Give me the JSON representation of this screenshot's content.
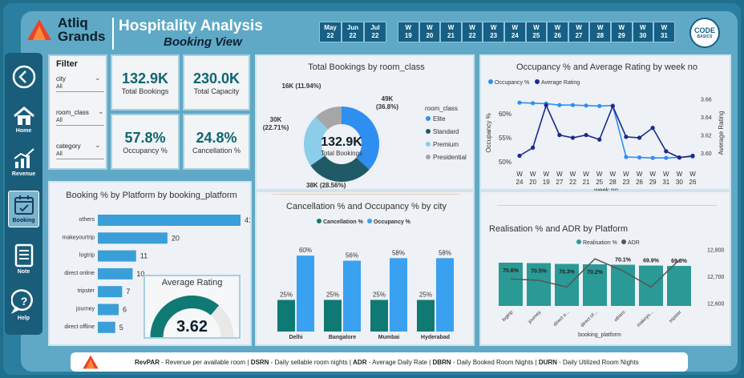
{
  "brand": {
    "name_line1": "Atliq",
    "name_line2": "Grands"
  },
  "header": {
    "title": "Hospitality Analysis",
    "subtitle": "Booking View"
  },
  "month_chips": [
    [
      "May",
      "22"
    ],
    [
      "Jun",
      "22"
    ],
    [
      "Jul",
      "22"
    ]
  ],
  "week_chips": [
    [
      "W",
      "19"
    ],
    [
      "W",
      "20"
    ],
    [
      "W",
      "21"
    ],
    [
      "W",
      "22"
    ],
    [
      "W",
      "23"
    ],
    [
      "W",
      "24"
    ],
    [
      "W",
      "25"
    ],
    [
      "W",
      "26"
    ],
    [
      "W",
      "27"
    ],
    [
      "W",
      "28"
    ],
    [
      "W",
      "29"
    ],
    [
      "W",
      "30"
    ],
    [
      "W",
      "31"
    ]
  ],
  "codebasics": {
    "line1": "CODE",
    "line2": "BASICS"
  },
  "nav": {
    "home": "Home",
    "revenue": "Revenue",
    "booking": "Booking",
    "note": "Note",
    "help": "Help"
  },
  "filter": {
    "title": "Filter",
    "city_label": "city",
    "city_value": "All",
    "room_class_label": "room_class",
    "room_class_value": "All",
    "category_label": "category",
    "category_value": "All"
  },
  "kpis": {
    "total_bookings": {
      "value": "132.9K",
      "label": "Total Bookings"
    },
    "total_capacity": {
      "value": "230.0K",
      "label": "Total Capacity"
    },
    "occupancy": {
      "value": "57.8%",
      "label": "Occupancy %"
    },
    "cancellation": {
      "value": "24.8%",
      "label": "Cancellation %"
    }
  },
  "colors": {
    "teal_dark": "#0f7a74",
    "blue": "#3aa0f0",
    "navy": "#1e3aa0",
    "platform_bar": "#3a9fd8"
  },
  "chart_data": [
    {
      "id": "booking_pct_platform",
      "type": "bar",
      "title": "Booking % by Platform by booking_platform",
      "categories": [
        "others",
        "makeyourtrip",
        "logtrip",
        "direct online",
        "tripster",
        "journey",
        "direct offline"
      ],
      "values": [
        41,
        20,
        11,
        10,
        7,
        6,
        5
      ]
    },
    {
      "id": "bookings_by_room_class",
      "type": "pie",
      "title": "Total Bookings by room_class",
      "center_value": "132.9K",
      "center_label": "Total Bookings",
      "legend_title": "room_class",
      "labels": [
        "Elite",
        "Standard",
        "Premium",
        "Presidential"
      ],
      "slice_labels": [
        "49K\n(36.8%)",
        "38K (28.56%)",
        "30K\n(22.71%)",
        "16K (11.94%)"
      ],
      "values": [
        36.8,
        28.56,
        22.71,
        11.94
      ],
      "colors": [
        "#2f8ff0",
        "#1f5a66",
        "#8ccdea",
        "#a6a6a6"
      ]
    },
    {
      "id": "cancellation_occupancy_city",
      "type": "bar",
      "title": "Cancellation % and Occupancy % by city",
      "categories": [
        "Delhi",
        "Bangalore",
        "Mumbai",
        "Hyderabad"
      ],
      "series": [
        {
          "name": "Cancellation %",
          "values": [
            25,
            25,
            25,
            25
          ],
          "color": "#0f7a74"
        },
        {
          "name": "Occupancy %",
          "values": [
            60,
            56,
            58,
            58
          ],
          "color": "#3aa0f0"
        }
      ]
    },
    {
      "id": "occupancy_rating_week",
      "type": "line",
      "title": "Occupancy % and Average Rating by week no",
      "xlabel": "week no",
      "ylabel": "Occupancy %",
      "y2label": "Average Rating",
      "categories": [
        "W 24",
        "W 20",
        "W 19",
        "W 27",
        "W 22",
        "W 21",
        "W 25",
        "W 28",
        "W 23",
        "W 26",
        "W 29",
        "W 31",
        "W 30",
        "W 26"
      ],
      "series": [
        {
          "name": "Occupancy %",
          "axis": "left",
          "values": [
            62.3,
            62.2,
            62.1,
            61.8,
            61.8,
            61.7,
            61.6,
            61.7,
            51.0,
            50.9,
            50.8,
            50.8,
            50.9,
            51.1
          ],
          "color": "#2f8ff0"
        },
        {
          "name": "Average Rating",
          "axis": "right",
          "values": [
            3.597,
            3.606,
            3.653,
            3.62,
            3.617,
            3.62,
            3.615,
            3.652,
            3.618,
            3.617,
            3.628,
            3.602,
            3.595,
            3.597
          ],
          "color": "#1a2a8c"
        }
      ],
      "y_ticks": [
        "50%",
        "55%",
        "60%"
      ],
      "y2_ticks": [
        "3.60",
        "3.62",
        "3.64",
        "3.66"
      ],
      "ylim": [
        49,
        64
      ],
      "y2lim": [
        3.585,
        3.665
      ]
    },
    {
      "id": "realisation_adr_platform",
      "type": "bar",
      "title": "Realisation % and ADR by Platform",
      "xlabel": "booking_platform",
      "categories": [
        "logtrip",
        "journey",
        "direct o...",
        "direct of...",
        "others",
        "makeyo...",
        "tripster"
      ],
      "series": [
        {
          "name": "Realisation %",
          "values": [
            70.6,
            70.5,
            70.3,
            70.2,
            70.1,
            69.9,
            69.8
          ],
          "labels": [
            "70.6%",
            "70.5%",
            "70.3%",
            "70.2%",
            "70.1%",
            "69.9%",
            "69.8%"
          ],
          "color": "#2a9a96"
        },
        {
          "name": "ADR",
          "axis": "right",
          "values": [
            12690,
            12685,
            12660,
            12765,
            12720,
            12660,
            12760
          ],
          "color": "#555555"
        }
      ],
      "y2_ticks": [
        "12,600",
        "12,700",
        "12,800"
      ],
      "y2lim": [
        12590,
        12810
      ]
    },
    {
      "id": "average_rating_gauge",
      "type": "gauge",
      "title": "Average Rating",
      "value": 3.62,
      "display": "3.62",
      "max": 5
    }
  ],
  "footer": {
    "t1b": "RevPAR",
    "t1": " - Revenue per available room | ",
    "t2b": "DSRN",
    "t2": " - Daily sellable room nights | ",
    "t3b": "ADR",
    "t3": " - Average Daily Rate | ",
    "t4b": "DBRN",
    "t4": " - Daily Booked Room Nights | ",
    "t5b": "DURN",
    "t5": " - Daily Utilized Room Nights"
  }
}
